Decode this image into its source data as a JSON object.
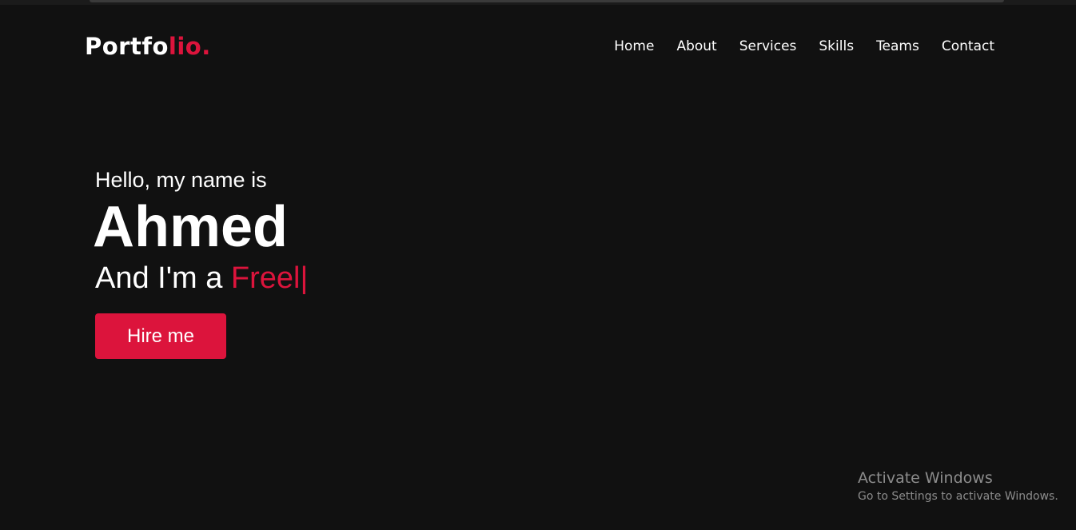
{
  "header": {
    "logo": {
      "main": "Portfo",
      "accent": "lio."
    },
    "nav": [
      "Home",
      "About",
      "Services",
      "Skills",
      "Teams",
      "Contact"
    ]
  },
  "hero": {
    "greeting": "Hello, my name is",
    "name": "Ahmed",
    "role_prefix": "And I'm a ",
    "role_typed": "Freel",
    "cursor": "|",
    "cta_label": "Hire me"
  },
  "watermark": {
    "title": "Activate Windows",
    "subtitle": "Go to Settings to activate Windows."
  },
  "colors": {
    "accent": "#dc143c",
    "background": "#111111",
    "text": "#ffffff"
  }
}
